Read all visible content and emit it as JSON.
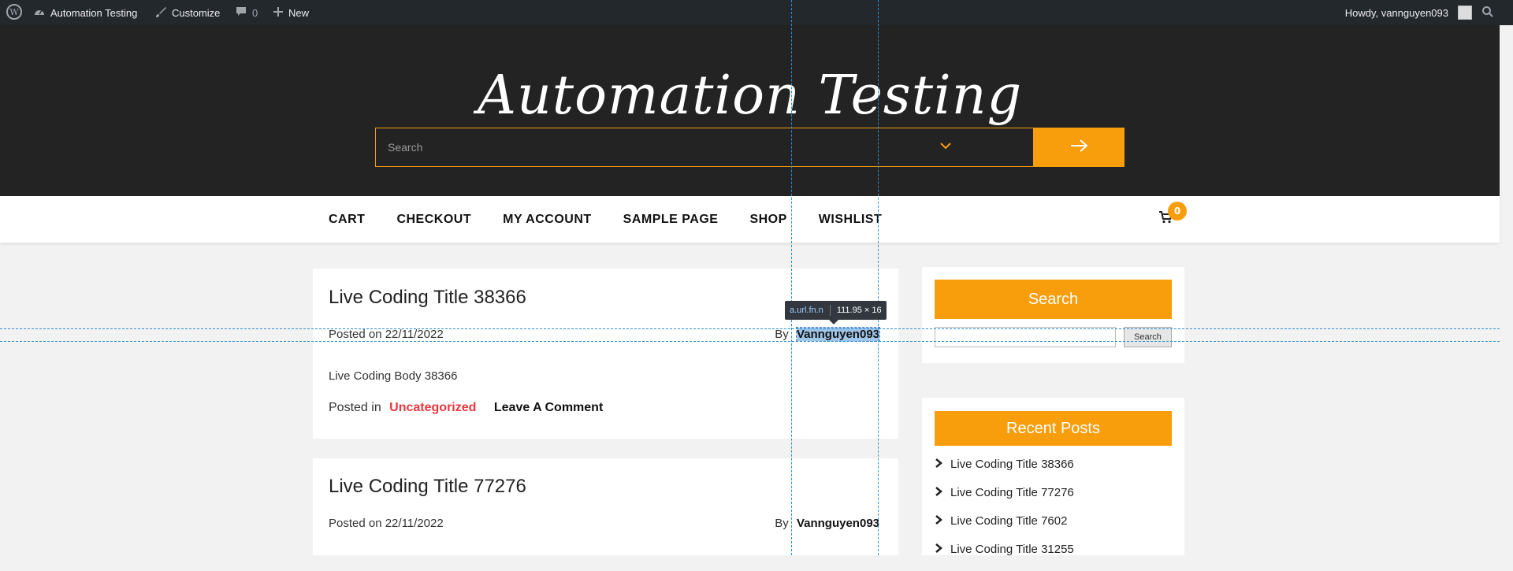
{
  "adminbar": {
    "site_name": "Automation Testing",
    "customize": "Customize",
    "comments_count": "0",
    "new_label": "New",
    "howdy": "Howdy, vannguyen093"
  },
  "header": {
    "site_title": "Automation Testing",
    "search_placeholder": "Search"
  },
  "nav": {
    "items": [
      "CART",
      "CHECKOUT",
      "MY ACCOUNT",
      "SAMPLE PAGE",
      "SHOP",
      "WISHLIST"
    ],
    "cart_count": "0"
  },
  "posts": [
    {
      "title": "Live Coding Title 38366",
      "posted_on": "Posted on 22/11/2022",
      "by": "By",
      "author": "Vannguyen093",
      "body": "Live Coding Body 38366",
      "posted_in": "Posted in",
      "category": "Uncategorized",
      "comment_link": "Leave A Comment"
    },
    {
      "title": "Live Coding Title 77276",
      "posted_on": "Posted on 22/11/2022",
      "by": "By",
      "author": "Vannguyen093"
    }
  ],
  "sidebar": {
    "search_title": "Search",
    "search_button": "Search",
    "recent_title": "Recent Posts",
    "recent": [
      "Live Coding Title 38366",
      "Live Coding Title 77276",
      "Live Coding Title 7602",
      "Live Coding Title 31255"
    ]
  },
  "devtools": {
    "selector": "a.url.fn.n",
    "dimensions": "111.95 × 16"
  },
  "colors": {
    "accent": "#f89d0b",
    "header_bg": "#232323",
    "adminbar_bg": "#23282d",
    "category_red": "#e8373d"
  },
  "icons": [
    "wordpress-icon",
    "dashboard-icon",
    "brush-icon",
    "comment-icon",
    "plus-icon",
    "avatar-icon",
    "search-icon",
    "chevron-down-icon",
    "arrow-right-icon",
    "cart-icon",
    "chevron-right-icon"
  ]
}
